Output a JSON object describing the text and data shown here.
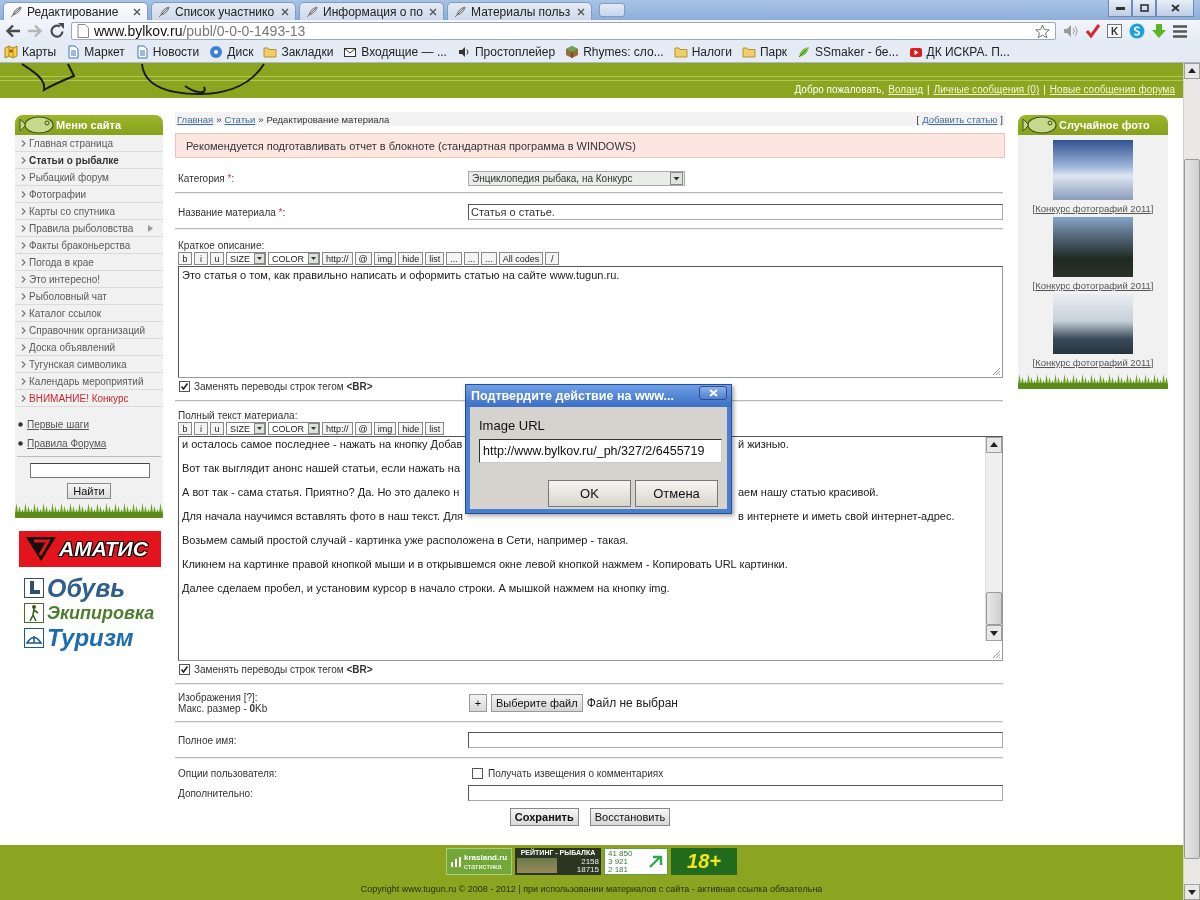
{
  "browser": {
    "tabs": [
      {
        "title": "Редактирование",
        "selected": true
      },
      {
        "title": "Список участнико",
        "selected": false
      },
      {
        "title": "Информация о по",
        "selected": false
      },
      {
        "title": "Материалы польз",
        "selected": false
      }
    ],
    "address": {
      "host": "www.bylkov.ru",
      "path": "/publ/0-0-0-1493-13"
    },
    "extensions": [
      {
        "kind": "speaker"
      },
      {
        "kind": "tick"
      },
      {
        "kind": "letter",
        "label": "K"
      },
      {
        "kind": "logo"
      },
      {
        "kind": "download"
      }
    ],
    "bookmarks": [
      {
        "label": "Карты",
        "kind": "map"
      },
      {
        "label": "Маркет",
        "kind": "page"
      },
      {
        "label": "Новости",
        "kind": "page"
      },
      {
        "label": "Диск",
        "kind": "disk"
      },
      {
        "label": "Закладки",
        "kind": "folder"
      },
      {
        "label": "Входящие — ...",
        "kind": "mail"
      },
      {
        "label": "Простоплейер",
        "kind": "speaker"
      },
      {
        "label": "Rhymes: сло...",
        "kind": "cube"
      },
      {
        "label": "Налоги",
        "kind": "folder"
      },
      {
        "label": "Парк",
        "kind": "folder"
      },
      {
        "label": "SSmaker - бе...",
        "kind": "leaf"
      },
      {
        "label": "ДК ИСКРА. П...",
        "kind": "video"
      }
    ]
  },
  "header": {
    "welcome": [
      {
        "kind": "text",
        "text": "Добро пожаловать,"
      },
      {
        "kind": "link",
        "text": "Воланд"
      },
      {
        "kind": "text",
        "text": "|"
      },
      {
        "kind": "link",
        "text": "Личные сообщения (0)"
      },
      {
        "kind": "text",
        "text": "|"
      },
      {
        "kind": "link",
        "text": "Новые сообщения форума"
      }
    ]
  },
  "sidebar": {
    "title": "Меню сайта",
    "items": [
      {
        "label": "Главная страница",
        "selected": false,
        "submenu": false,
        "kind": "link"
      },
      {
        "label": "Статьи о рыбалке",
        "selected": true,
        "submenu": false,
        "kind": "link"
      },
      {
        "label": "Рыбацкий форум",
        "selected": false,
        "submenu": false,
        "kind": "link"
      },
      {
        "label": "Фотографии",
        "selected": false,
        "submenu": false,
        "kind": "link"
      },
      {
        "label": "Карты со спутника",
        "selected": false,
        "submenu": false,
        "kind": "link"
      },
      {
        "label": "Правила рыболовства",
        "selected": false,
        "submenu": true,
        "kind": "link"
      },
      {
        "label": "Факты браконьерства",
        "selected": false,
        "submenu": false,
        "kind": "link"
      },
      {
        "label": "Погода в крае",
        "selected": false,
        "submenu": false,
        "kind": "link"
      },
      {
        "label": "Это интересно!",
        "selected": false,
        "submenu": false,
        "kind": "link"
      },
      {
        "label": "Рыболовный чат",
        "selected": false,
        "submenu": false,
        "kind": "link"
      },
      {
        "label": "Каталог ссылок",
        "selected": false,
        "submenu": false,
        "kind": "link"
      },
      {
        "label": "Справочник организаций",
        "selected": false,
        "submenu": false,
        "kind": "link"
      },
      {
        "label": "Доска объявлений",
        "selected": false,
        "submenu": false,
        "kind": "link"
      },
      {
        "label": "Тугунская символика",
        "selected": false,
        "submenu": false,
        "kind": "link"
      },
      {
        "label": "Календарь мероприятий",
        "selected": false,
        "submenu": false,
        "kind": "link"
      },
      {
        "label": "ВНИМАНИЕ! Конкурс",
        "selected": false,
        "submenu": false,
        "kind": "alert"
      }
    ],
    "links": [
      "Первые шаги",
      "Правила Форума"
    ],
    "search_button": "Найти"
  },
  "ads": {
    "brand": "АМАТИС",
    "categories": [
      {
        "label": "Обувь",
        "kind": "boot",
        "color": "#2f5f8c"
      },
      {
        "label": "Экипировка",
        "kind": "hiker",
        "color": "#4d7d2c"
      },
      {
        "label": "Туризм",
        "kind": "tent",
        "color": "#1c6cb0"
      }
    ]
  },
  "breadcrumbs": [
    {
      "kind": "link",
      "text": "Главная"
    },
    {
      "kind": "text",
      "text": "»"
    },
    {
      "kind": "link",
      "text": "Статьи"
    },
    {
      "kind": "text",
      "text": "»"
    },
    {
      "kind": "text",
      "text": "Редактирование материала"
    }
  ],
  "add_article": [
    {
      "kind": "text",
      "text": "["
    },
    {
      "kind": "link",
      "text": "Добавить статью"
    },
    {
      "kind": "text",
      "text": "]"
    }
  ],
  "notice": "Рекомендуется подготавливать отчет в блокноте (стандартная программа в WINDOWS)",
  "form": {
    "category": {
      "label": "Категория",
      "required_mark": "*",
      "label_end": ":",
      "value": "Энциклопедия рыбака, на Конкурс"
    },
    "title": {
      "label": "Название материала",
      "required_mark": "*",
      "label_end": ":",
      "value": "Статья о статье."
    },
    "short_description": {
      "label": "Краткое описание:",
      "toolbar": [
        {
          "label": "b",
          "kind": "button"
        },
        {
          "label": "i",
          "kind": "button"
        },
        {
          "label": "u",
          "kind": "button"
        },
        {
          "label": "SIZE",
          "kind": "select"
        },
        {
          "label": "COLOR",
          "kind": "select"
        },
        {
          "label": "http://",
          "kind": "button"
        },
        {
          "label": "@",
          "kind": "button"
        },
        {
          "label": "img",
          "kind": "button"
        },
        {
          "label": "hide",
          "kind": "button"
        },
        {
          "label": "list",
          "kind": "button"
        },
        {
          "label": "...",
          "kind": "button"
        },
        {
          "label": "...",
          "kind": "button"
        },
        {
          "label": "...",
          "kind": "button"
        },
        {
          "label": "All codes",
          "kind": "button"
        },
        {
          "label": "/",
          "kind": "button"
        }
      ],
      "lines": [
        {
          "text": "Это статья о том, как правильно написать и оформить статью на сайте www.tugun.ru."
        }
      ],
      "replace_br": {
        "label": "Заменять переводы строк тегом **<BR>**",
        "checked": true
      }
    },
    "full_text": {
      "label": "Полный текст материала:",
      "toolbar": [
        {
          "label": "b",
          "kind": "button"
        },
        {
          "label": "i",
          "kind": "button"
        },
        {
          "label": "u",
          "kind": "button"
        },
        {
          "label": "SIZE",
          "kind": "select"
        },
        {
          "label": "COLOR",
          "kind": "select"
        },
        {
          "label": "http://",
          "kind": "button"
        },
        {
          "label": "@",
          "kind": "button"
        },
        {
          "label": "img",
          "kind": "button"
        },
        {
          "label": "hide",
          "kind": "button"
        },
        {
          "label": "list",
          "kind": "button"
        }
      ],
      "lines": [
        {
          "text": "и осталось самое последнее - нажать на кнопку Добав",
          "after_dialog": "й жизнью."
        },
        {
          "text": "Вот так выглядит анонс нашей статьи, если нажать на"
        },
        {
          "text": "А вот так - сама статья. Приятно? Да. Но это далеко н",
          "after_dialog": "аем нашу статью красивой."
        },
        {
          "text": "Для начала научимся вставлять фото в наш текст. Для",
          "after_dialog": "в интернете и иметь свой интернет-адрес."
        },
        {
          "text": "Возьмем самый простой случай - картинка уже расположена в Сети, например - такая."
        },
        {
          "text": "Кликнем на картинке правой кнопкой мыши и в открывшемся окне левой кнопкой нажмем  - Копировать URL картинки."
        },
        {
          "text": "Далее сделаем пробел, и установим курсор в начало строки. А мышкой нажмем на кнопку img."
        }
      ],
      "replace_br": {
        "label": "Заменять переводы строк тегом **<BR>**",
        "checked": true
      }
    },
    "images": {
      "label": "Изображения [?]:",
      "hint": "Макс. размер - **0**Kb",
      "add_button": "+",
      "choose_button": "Выберите файл",
      "status": "Файл не выбран"
    },
    "full_name": {
      "label": "Полное имя:"
    },
    "options": {
      "label": "Опции пользователя:",
      "checkbox": {
        "label": "Получать извещения о комментариях",
        "checked": false
      }
    },
    "additional": {
      "label": "Дополнительно:"
    },
    "buttons": [
      {
        "label": "Сохранить",
        "kind": "primary"
      },
      {
        "label": "Восстановить",
        "kind": "secondary"
      }
    ]
  },
  "random_photo": {
    "title": "Случайное фото",
    "photos": [
      {
        "caption": [
          {
            "kind": "text",
            "text": "["
          },
          {
            "kind": "link",
            "text": "Конкурс фотографий 2011"
          },
          {
            "kind": "text",
            "text": "]"
          }
        ]
      },
      {
        "caption": [
          {
            "kind": "text",
            "text": "["
          },
          {
            "kind": "link",
            "text": "Конкурс фотографий 2011"
          },
          {
            "kind": "text",
            "text": "]"
          }
        ]
      },
      {
        "caption": [
          {
            "kind": "text",
            "text": "["
          },
          {
            "kind": "link",
            "text": "Конкурс фотографий 2011"
          },
          {
            "kind": "text",
            "text": "]"
          }
        ]
      }
    ]
  },
  "dialog": {
    "title": "Подтвердите действие на www...",
    "prompt": "Image URL",
    "value": "http://www.bylkov.ru/_ph/327/2/6455719",
    "buttons": [
      "OK",
      "Отмена"
    ]
  },
  "footer": {
    "counters": [
      {
        "kind": "stats",
        "lines": [
          "krasland.ru",
          "статистика"
        ]
      },
      {
        "kind": "rating",
        "lines": [
          "РЕЙТИНГ - РЫБАЛКА",
          "2158",
          "18715"
        ]
      },
      {
        "kind": "visits",
        "lines": [
          "41 850",
          "3 921",
          "2 181"
        ]
      },
      {
        "kind": "age",
        "lines": [
          "18+"
        ]
      }
    ],
    "copyright": "Copyright www.tugun.ru © 2008 - 2012 | при использовании материалов с сайта - активная ссылка обязательна"
  }
}
